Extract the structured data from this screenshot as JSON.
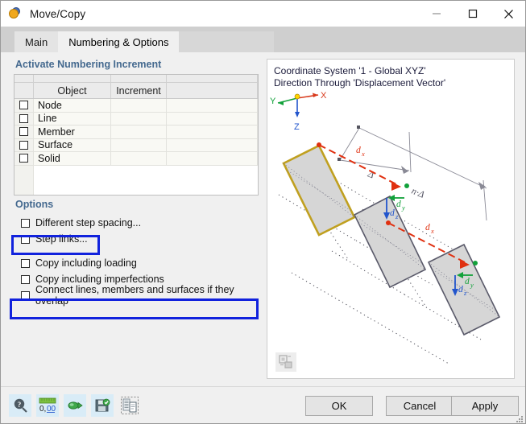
{
  "window": {
    "title": "Move/Copy",
    "icon": "move-copy-icon",
    "minimize_label": "Minimize",
    "maximize_label": "Maximize",
    "close_label": "Close"
  },
  "tabs": [
    {
      "label": "Main",
      "active": false
    },
    {
      "label": "Numbering & Options",
      "active": true
    }
  ],
  "numbering_group": {
    "title": "Activate Numbering Increment",
    "columns": [
      "",
      "Object",
      "Increment",
      ""
    ],
    "rows": [
      {
        "checked": false,
        "object": "Node",
        "increment": ""
      },
      {
        "checked": false,
        "object": "Line",
        "increment": ""
      },
      {
        "checked": false,
        "object": "Member",
        "increment": ""
      },
      {
        "checked": false,
        "object": "Surface",
        "increment": ""
      },
      {
        "checked": false,
        "object": "Solid",
        "increment": ""
      }
    ]
  },
  "options_group": {
    "title": "Options",
    "items": [
      {
        "label": "Different step spacing...",
        "checked": false,
        "highlighted": false
      },
      {
        "label": "Step links...",
        "checked": false,
        "highlighted": true
      },
      {
        "label": "Copy including loading",
        "checked": false,
        "highlighted": false
      },
      {
        "label": "Copy including imperfections",
        "checked": false,
        "highlighted": false
      },
      {
        "label": "Connect lines, members and surfaces if they overlap",
        "checked": false,
        "highlighted": true
      }
    ]
  },
  "preview": {
    "caption_line1": "Coordinate System '1 - Global XYZ'",
    "caption_line2": "Direction Through 'Displacement Vector'",
    "axes": {
      "x": "X",
      "y": "Y",
      "z": "Z"
    },
    "axis_colors": {
      "x": "#d8391b",
      "y": "#12a13a",
      "z": "#2255cc"
    },
    "dimension_labels": [
      "Δ",
      "n·Δ"
    ],
    "vector_labels": [
      "d",
      "d",
      "d",
      "d",
      "d",
      "d"
    ],
    "vector_label_x": "d",
    "vector_sub_x": "x",
    "vector_sub_y": "y",
    "vector_sub_z": "z",
    "tool_icon": "copy-object-icon"
  },
  "footer": {
    "tools": [
      {
        "name": "help-icon",
        "label": "Help"
      },
      {
        "name": "units-icon",
        "label": "Units and decimal places"
      },
      {
        "name": "settings-icon",
        "label": "Settings"
      },
      {
        "name": "save-settings-icon",
        "label": "Save settings"
      },
      {
        "name": "detail-icon",
        "label": "Details"
      }
    ],
    "buttons": [
      {
        "label": "OK",
        "name": "ok-button"
      },
      {
        "label": "Cancel",
        "name": "cancel-button"
      },
      {
        "label": "Apply",
        "name": "apply-button"
      }
    ]
  },
  "colors": {
    "accent_blue": "#1122dd",
    "group_title": "#44698f",
    "window_bg": "#f0f0f0",
    "tabstrip": "#cfcfcf"
  }
}
